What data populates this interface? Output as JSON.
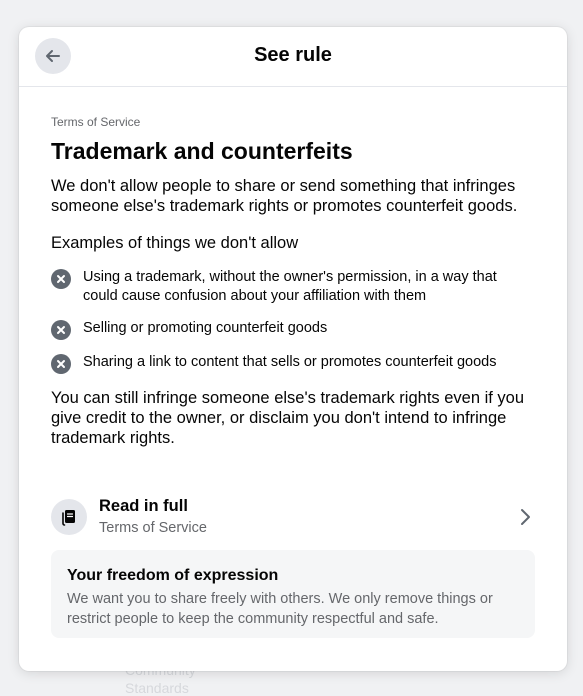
{
  "background": {
    "faded_text": [
      "Community",
      "Standards"
    ]
  },
  "header": {
    "title": "See rule"
  },
  "rule": {
    "eyebrow": "Terms of Service",
    "heading": "Trademark and counterfeits",
    "description": "We don't allow people to share or send something that infringes someone else's trademark rights or promotes counterfeit goods.",
    "examples_title": "Examples of things we don't allow",
    "examples": [
      "Using a trademark, without the owner's permission, in a way that could cause confusion about your affiliation with them",
      "Selling or promoting counterfeit goods",
      "Sharing a link to content that sells or promotes counterfeit goods"
    ],
    "note": "You can still infringe someone else's trademark rights even if you give credit to the owner, or disclaim you don't intend to infringe trademark rights."
  },
  "read_full": {
    "title": "Read in full",
    "subtitle": "Terms of Service"
  },
  "freedom": {
    "title": "Your freedom of expression",
    "text": "We want you to share freely with others. We only remove things or restrict people to keep the community respectful and safe."
  },
  "icons": {
    "back": "arrow-left-icon",
    "example": "x-circle-icon",
    "document": "document-icon",
    "chevron": "chevron-right-icon"
  },
  "colors": {
    "icon_gray": "#606770",
    "secondary_text": "#65676b",
    "icon_bg": "#e4e6eb"
  }
}
